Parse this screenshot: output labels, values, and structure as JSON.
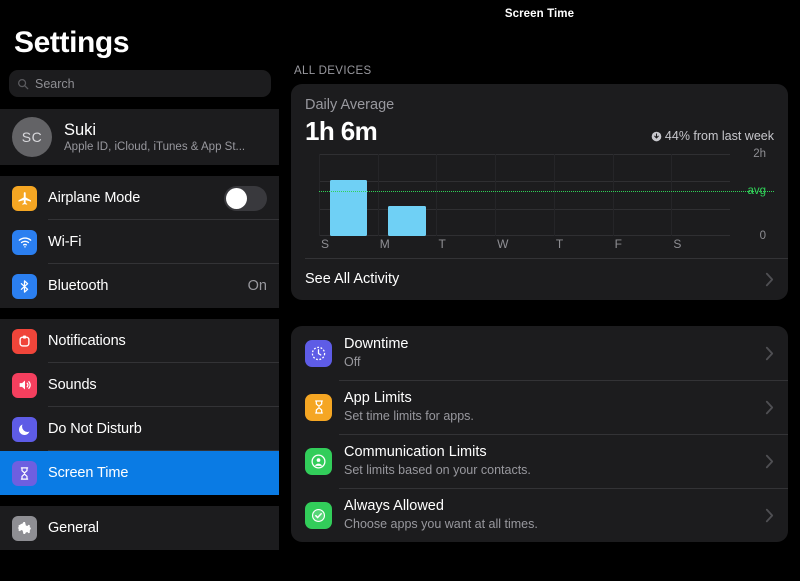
{
  "sidebar": {
    "title": "Settings",
    "search_placeholder": "Search",
    "profile": {
      "initials": "SC",
      "name": "Suki",
      "subtitle": "Apple ID, iCloud, iTunes & App St..."
    },
    "group1": [
      {
        "label": "Airplane Mode",
        "value": "",
        "icon": "airplane-icon",
        "control": "toggle",
        "toggle_on": false
      },
      {
        "label": "Wi-Fi",
        "value": "",
        "icon": "wifi-icon",
        "control": "none"
      },
      {
        "label": "Bluetooth",
        "value": "On",
        "icon": "bluetooth-icon",
        "control": "value"
      }
    ],
    "group2": [
      {
        "label": "Notifications",
        "icon": "notifications-icon",
        "selected": false
      },
      {
        "label": "Sounds",
        "icon": "sounds-icon",
        "selected": false
      },
      {
        "label": "Do Not Disturb",
        "icon": "moon-icon",
        "selected": false
      },
      {
        "label": "Screen Time",
        "icon": "hourglass-icon",
        "selected": true
      }
    ],
    "group3": [
      {
        "label": "General",
        "icon": "gear-icon"
      }
    ]
  },
  "main": {
    "nav_title": "Screen Time",
    "section_header": "ALL DEVICES",
    "summary": {
      "label": "Daily Average",
      "value": "1h 6m",
      "delta": "44% from last week",
      "delta_direction": "down"
    },
    "see_all_activity": "See All Activity",
    "features": [
      {
        "title": "Downtime",
        "subtitle": "Off",
        "icon": "downtime-clock-icon",
        "color": "#5E5CE6"
      },
      {
        "title": "App Limits",
        "subtitle": "Set time limits for apps.",
        "icon": "hourglass-icon",
        "color": "#F5A623"
      },
      {
        "title": "Communication Limits",
        "subtitle": "Set limits based on your contacts.",
        "icon": "person-circle-icon",
        "color": "#32CD5A"
      },
      {
        "title": "Always Allowed",
        "subtitle": "Choose apps you want at all times.",
        "icon": "checkmark-badge-icon",
        "color": "#32CD5A"
      }
    ]
  },
  "chart_data": {
    "type": "bar",
    "title": "Daily Average",
    "categories": [
      "S",
      "M",
      "T",
      "W",
      "T",
      "F",
      "S"
    ],
    "values": [
      1.37,
      0.73,
      0,
      0,
      0,
      0,
      0
    ],
    "ylabel": "",
    "xlabel": "",
    "ylim": [
      0,
      2
    ],
    "ytick_labels": [
      "0",
      "2h"
    ],
    "average_line": {
      "label": "avg",
      "value": 1.1,
      "color": "#30D158",
      "style": "dotted"
    },
    "bar_color": "#6FD0F5",
    "grid": true,
    "legend": "none"
  },
  "colors": {
    "accent": "#0A7BE4",
    "card": "#1C1C1E",
    "background": "#000000",
    "bar": "#6FD0F5",
    "avg": "#30D158"
  }
}
